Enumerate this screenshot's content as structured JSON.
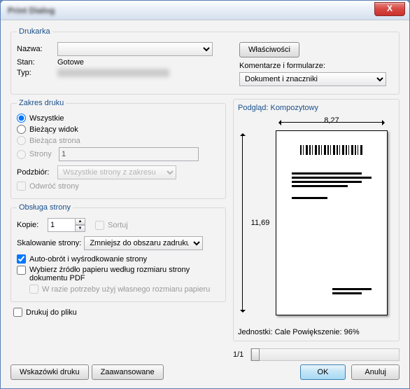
{
  "title": "Print Dialog",
  "close": "X",
  "printer": {
    "legend": "Drukarka",
    "name_lbl": "Nazwa:",
    "name_val": "",
    "props_btn": "Właściwości",
    "state_lbl": "Stan:",
    "state_val": "Gotowe",
    "type_lbl": "Typ:",
    "type_val": "",
    "comments_lbl": "Komentarze i formularze:",
    "comments_val": "Dokument i znaczniki"
  },
  "range": {
    "legend": "Zakres druku",
    "all": "Wszystkie",
    "view": "Bieżący widok",
    "page": "Bieżąca strona",
    "pages": "Strony",
    "pages_val": "1",
    "subset_lbl": "Podzbiór:",
    "subset_val": "Wszystkie strony z zakresu",
    "reverse": "Odwróć strony"
  },
  "handling": {
    "legend": "Obsługa strony",
    "copies_lbl": "Kopie:",
    "copies_val": "1",
    "sort": "Sortuj",
    "scale_lbl": "Skalowanie strony:",
    "scale_val": "Zmniejsz do obszaru zadruku",
    "autorotate": "Auto-obrót i wyśrodkowanie strony",
    "papersrc": "Wybierz źródło papieru według rozmiaru strony dokumentu PDF",
    "custom": "W razie potrzeby użyj własnego rozmiaru papieru"
  },
  "tofile": "Drukuj do pliku",
  "preview": {
    "title": "Podgląd: Kompozytowy",
    "width": "8,27",
    "height": "11,69",
    "units": "Jednostki: Cale Powiększenie:  96%",
    "page": "1/1"
  },
  "footer": {
    "tips": "Wskazówki druku",
    "adv": "Zaawansowane",
    "ok": "OK",
    "cancel": "Anuluj"
  }
}
